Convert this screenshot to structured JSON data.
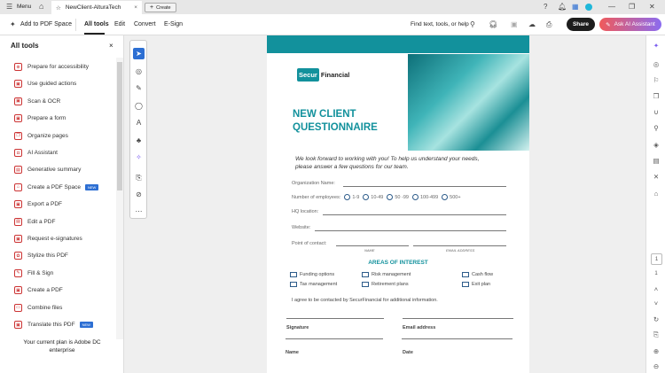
{
  "titlebar": {
    "menu": "Menu",
    "tab_title": "NewClient-AlturaTech",
    "create": "Create"
  },
  "toolbar": {
    "add_space": "Add to PDF Space",
    "tabs": [
      "All tools",
      "Edit",
      "Convert",
      "E-Sign"
    ],
    "search": "Find text, tools, or help",
    "share": "Share",
    "ask_ai": "Ask AI Assistant"
  },
  "left": {
    "title": "All tools",
    "items": [
      "Prepare for accessibility",
      "Use guided actions",
      "Scan & OCR",
      "Prepare a form",
      "Organize pages",
      "AI Assistant",
      "Generative summary",
      "Create a PDF Space",
      "Export a PDF",
      "Edit a PDF",
      "Request e-signatures",
      "Stylize this PDF",
      "Fill & Sign",
      "Create a PDF",
      "Combine files",
      "Translate this PDF"
    ],
    "new_badge": "NEW",
    "plan": "Your current plan is Adobe DC enterprise"
  },
  "doc": {
    "logo_a": "Secur",
    "logo_b": "Financial",
    "title1": "NEW CLIENT",
    "title2": "QUESTIONNAIRE",
    "intro1": "We look forward to working with you! To help us understand your needs,",
    "intro2": "please answer a few questions for our team.",
    "org": "Organization Name:",
    "employees": "Number of employees:",
    "emp_options": [
      "1-9",
      "10-49",
      "50 -99",
      "100-499",
      "500+"
    ],
    "hq": "HQ location:",
    "website": "Website:",
    "contact": "Point of contact:",
    "name_cap": "NAME",
    "email_cap": "EMAIL ADDRESS",
    "areas_title": "AREAS OF INTEREST",
    "areas": [
      "Funding options",
      "Risk management",
      "Cash flow",
      "Tax management",
      "Retirement plans",
      "Exit plan"
    ],
    "agree": "I agree to be contacted by SecurFinancial for additional information.",
    "signature": "Signature",
    "email": "Email address",
    "name": "Name",
    "date": "Date"
  },
  "right": {
    "page_num": "1",
    "page_total": "1"
  },
  "colors": {
    "teal": "#12919c",
    "accent_ai": "#e8525f"
  }
}
